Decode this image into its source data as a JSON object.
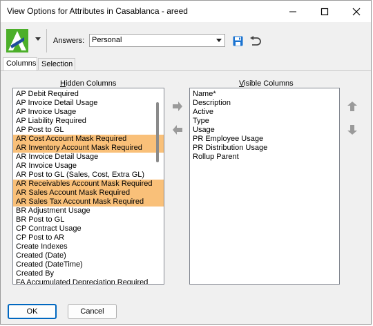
{
  "window": {
    "title": "View Options for Attributes in Casablanca - areed",
    "minimize_icon": "minimize-icon",
    "maximize_icon": "maximize-icon",
    "close_icon": "close-icon"
  },
  "toolbar": {
    "logo_icon": "app-logo-icon",
    "answers_label": "Answers:",
    "answers_value": "Personal",
    "save_icon": "save-icon",
    "undo_icon": "undo-icon"
  },
  "tabs": [
    {
      "label": "Columns",
      "active": true
    },
    {
      "label": "Selection",
      "active": false
    }
  ],
  "hidden_columns": {
    "label": "Hidden Columns",
    "items": [
      {
        "label": "AP Debit Required",
        "highlighted": false
      },
      {
        "label": "AP Invoice Detail Usage",
        "highlighted": false
      },
      {
        "label": "AP Invoice Usage",
        "highlighted": false
      },
      {
        "label": "AP Liability Required",
        "highlighted": false
      },
      {
        "label": "AP Post to GL",
        "highlighted": false
      },
      {
        "label": "AR Cost Account Mask Required",
        "highlighted": true
      },
      {
        "label": "AR Inventory Account Mask Required",
        "highlighted": true
      },
      {
        "label": "AR Invoice Detail Usage",
        "highlighted": false
      },
      {
        "label": "AR Invoice Usage",
        "highlighted": false
      },
      {
        "label": "AR Post to GL (Sales, Cost, Extra GL)",
        "highlighted": false
      },
      {
        "label": "AR Receivables Account Mask Required",
        "highlighted": true
      },
      {
        "label": "AR Sales Account Mask Required",
        "highlighted": true
      },
      {
        "label": "AR Sales Tax Account Mask Required",
        "highlighted": true
      },
      {
        "label": "BR Adjustment Usage",
        "highlighted": false
      },
      {
        "label": "BR Post to GL",
        "highlighted": false
      },
      {
        "label": "CP Contract Usage",
        "highlighted": false
      },
      {
        "label": "CP Post to AR",
        "highlighted": false
      },
      {
        "label": "Create Indexes",
        "highlighted": false
      },
      {
        "label": "Created (Date)",
        "highlighted": false
      },
      {
        "label": "Created (DateTime)",
        "highlighted": false
      },
      {
        "label": "Created By",
        "highlighted": false
      },
      {
        "label": "FA Accumulated Depreciation Required",
        "highlighted": false
      }
    ]
  },
  "visible_columns": {
    "label": "Visible Columns",
    "items": [
      "Name*",
      "Description",
      "Active",
      "Type",
      "Usage",
      "PR Employee Usage",
      "PR Distribution Usage",
      "Rollup Parent"
    ]
  },
  "move_buttons": {
    "move_right_icon": "arrow-right-icon",
    "move_left_icon": "arrow-left-icon",
    "move_up_icon": "arrow-up-icon",
    "move_down_icon": "arrow-down-icon"
  },
  "footer": {
    "ok_label": "OK",
    "cancel_label": "Cancel"
  },
  "colors": {
    "highlight": "#f9c079",
    "accent": "#0067c0"
  }
}
